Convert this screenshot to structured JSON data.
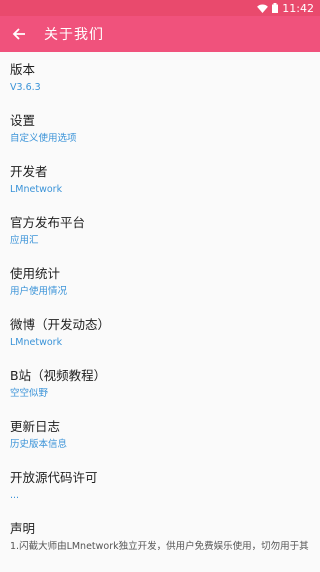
{
  "status": {
    "time": "11:42"
  },
  "appbar": {
    "title": "关于我们"
  },
  "items": [
    {
      "title": "版本",
      "subtitle": "V3.6.3"
    },
    {
      "title": "设置",
      "subtitle": "自定义使用选项"
    },
    {
      "title": "开发者",
      "subtitle": "LMnetwork"
    },
    {
      "title": "官方发布平台",
      "subtitle": "应用汇"
    },
    {
      "title": "使用统计",
      "subtitle": "用户使用情况"
    },
    {
      "title": "微博（开发动态）",
      "subtitle": "LMnetwork"
    },
    {
      "title": "B站（视频教程）",
      "subtitle": "空空似野"
    },
    {
      "title": "更新日志",
      "subtitle": "历史版本信息"
    },
    {
      "title": "开放源代码许可",
      "subtitle": "..."
    },
    {
      "title": "声明",
      "subtitle": "1.闪截大师由LMnetwork独立开发，供用户免费娱乐使用，切勿用于其"
    }
  ],
  "colors": {
    "statusbar": "#e94a6d",
    "appbar": "#f0527c",
    "link": "#3a93d8"
  }
}
